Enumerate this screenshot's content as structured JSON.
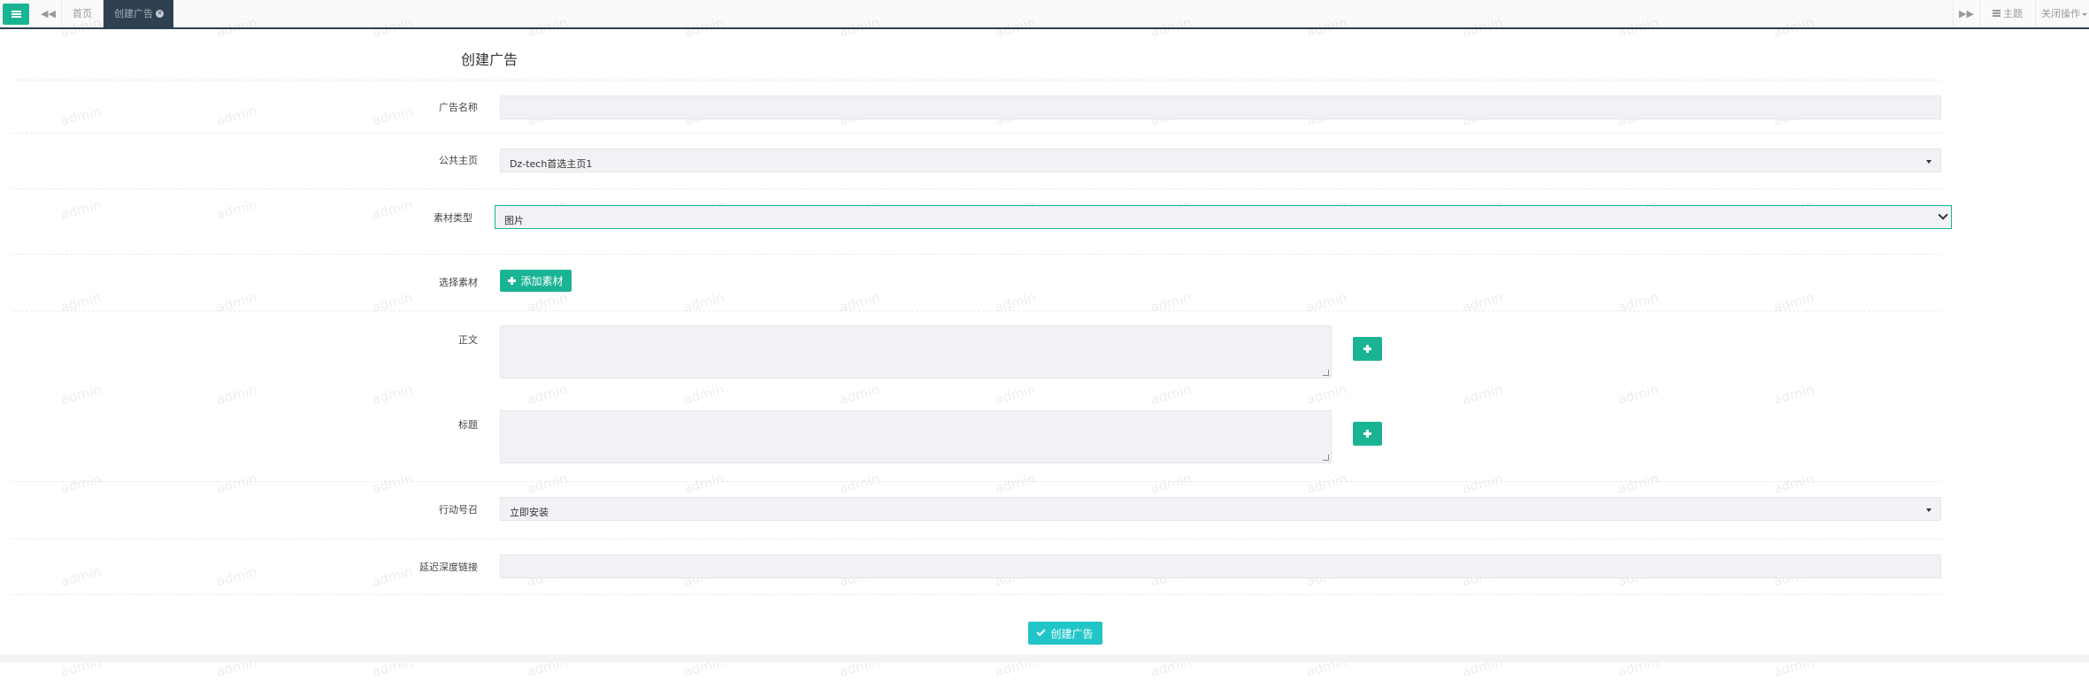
{
  "topbar": {
    "menu_icon": "hamburger-icon",
    "prev_icon": "double-left-icon",
    "next_icon": "double-right-icon",
    "tabs": [
      {
        "label": "首页"
      },
      {
        "label": "创建广告"
      }
    ],
    "theme_label": "主题",
    "close_ops_label": "关闭操作"
  },
  "watermark": "admin",
  "form": {
    "title": "创建广告",
    "fields": {
      "ad_name": {
        "label": "广告名称",
        "value": ""
      },
      "public_page": {
        "label": "公共主页",
        "value": "Dz-tech首选主页1"
      },
      "material_type": {
        "label": "素材类型",
        "value": "图片"
      },
      "select_material": {
        "label": "选择素材",
        "button": "添加素材"
      },
      "body_text": {
        "label": "正文",
        "value": ""
      },
      "headline": {
        "label": "标题",
        "value": ""
      },
      "call_to_action": {
        "label": "行动号召",
        "value": "立即安装"
      },
      "deep_link": {
        "label": "延迟深度链接",
        "value": ""
      }
    },
    "submit_label": "创建广告"
  },
  "colors": {
    "accent": "#1ab394",
    "nav_dark": "#2f4050",
    "input_bg": "#f0f2f5"
  }
}
